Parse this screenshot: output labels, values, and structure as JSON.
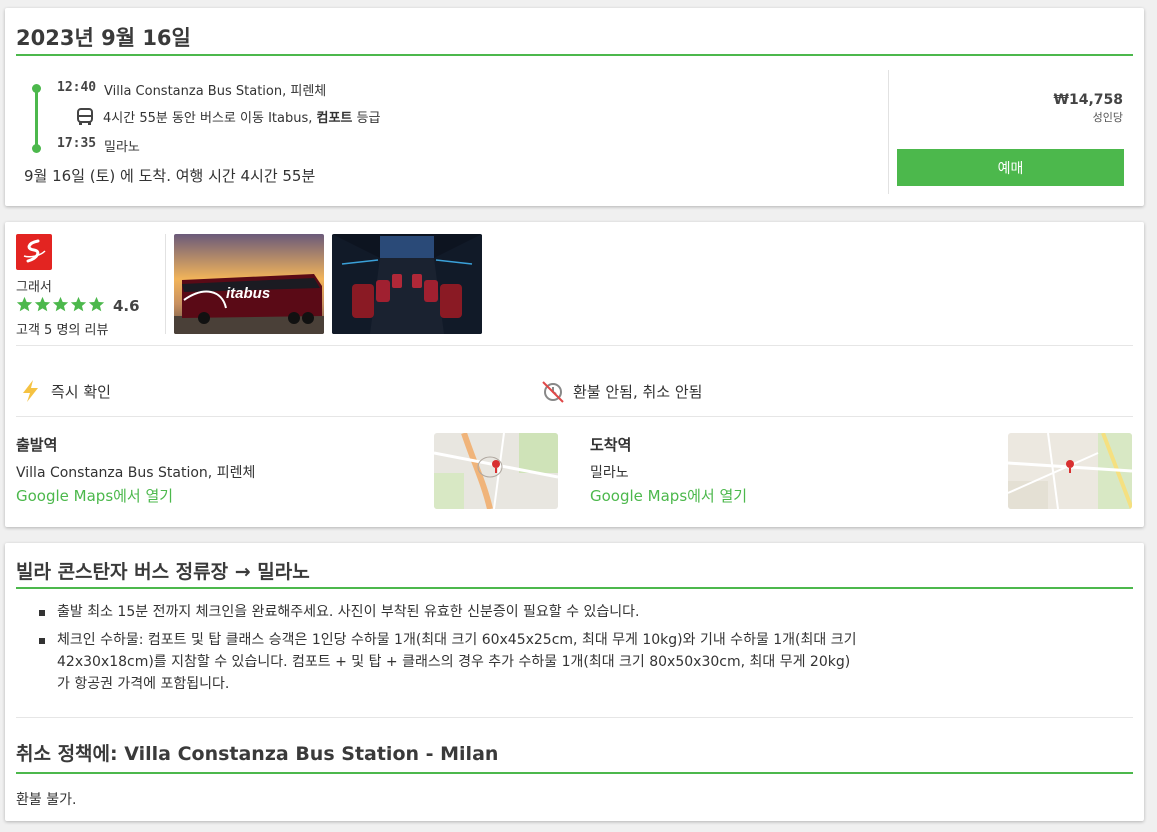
{
  "trip": {
    "date_title": "2023년 9월 16일",
    "departure_time": "12:40",
    "departure_station": "Villa Constanza Bus Station, 피렌체",
    "duration_text": "4시간 55분 동안 버스로 이동 Itabus, ",
    "class_text": "컴포트",
    "class_suffix": " 등급",
    "arrival_time": "17:35",
    "arrival_station": "밀라노",
    "arrival_summary": "9월 16일 (토) 에 도착. 여행 시간 4시간 55분",
    "price": "₩14,758",
    "price_unit": "성인당",
    "book_label": "예매"
  },
  "operator": {
    "name": "그래서",
    "rating": "4.6",
    "star_count": 5,
    "reviews": "고객 5 명의 리뷰",
    "logo_color": "#e32421"
  },
  "features": {
    "instant": "즉시 확인",
    "refund": "환불 안됨, 취소 안됨"
  },
  "departure": {
    "label": "출발역",
    "station": "Villa Constanza Bus Station, 피렌체",
    "map_link": "Google Maps에서 열기"
  },
  "arrival": {
    "label": "도착역",
    "station": "밀라노",
    "map_link": "Google Maps에서 열기"
  },
  "info": {
    "route_title": "빌라 콘스탄자 버스 정류장 → 밀라노",
    "rules": [
      "출발 최소 15분 전까지 체크인을 완료해주세요. 사진이 부착된 유효한 신분증이 필요할 수 있습니다.",
      "체크인 수하물: 컴포트 및 탑 클래스 승객은 1인당 수하물 1개(최대 크기 60x45x25cm, 최대 무게 10kg)와 기내 수하물 1개(최대 크기 42x30x18cm)를 지참할 수 있습니다. 컴포트 + 및 탑 + 클래스의 경우 추가 수하물 1개(최대 크기 80x50x30cm, 최대 무게 20kg)가 항공권 가격에 포함됩니다."
    ],
    "cancel_title": "취소 정책에: Villa Constanza Bus Station - Milan",
    "cancel_text": "환불 불가."
  },
  "colors": {
    "accent": "#4cb84c",
    "star": "#4cb84c",
    "lightning": "#f5c242"
  }
}
